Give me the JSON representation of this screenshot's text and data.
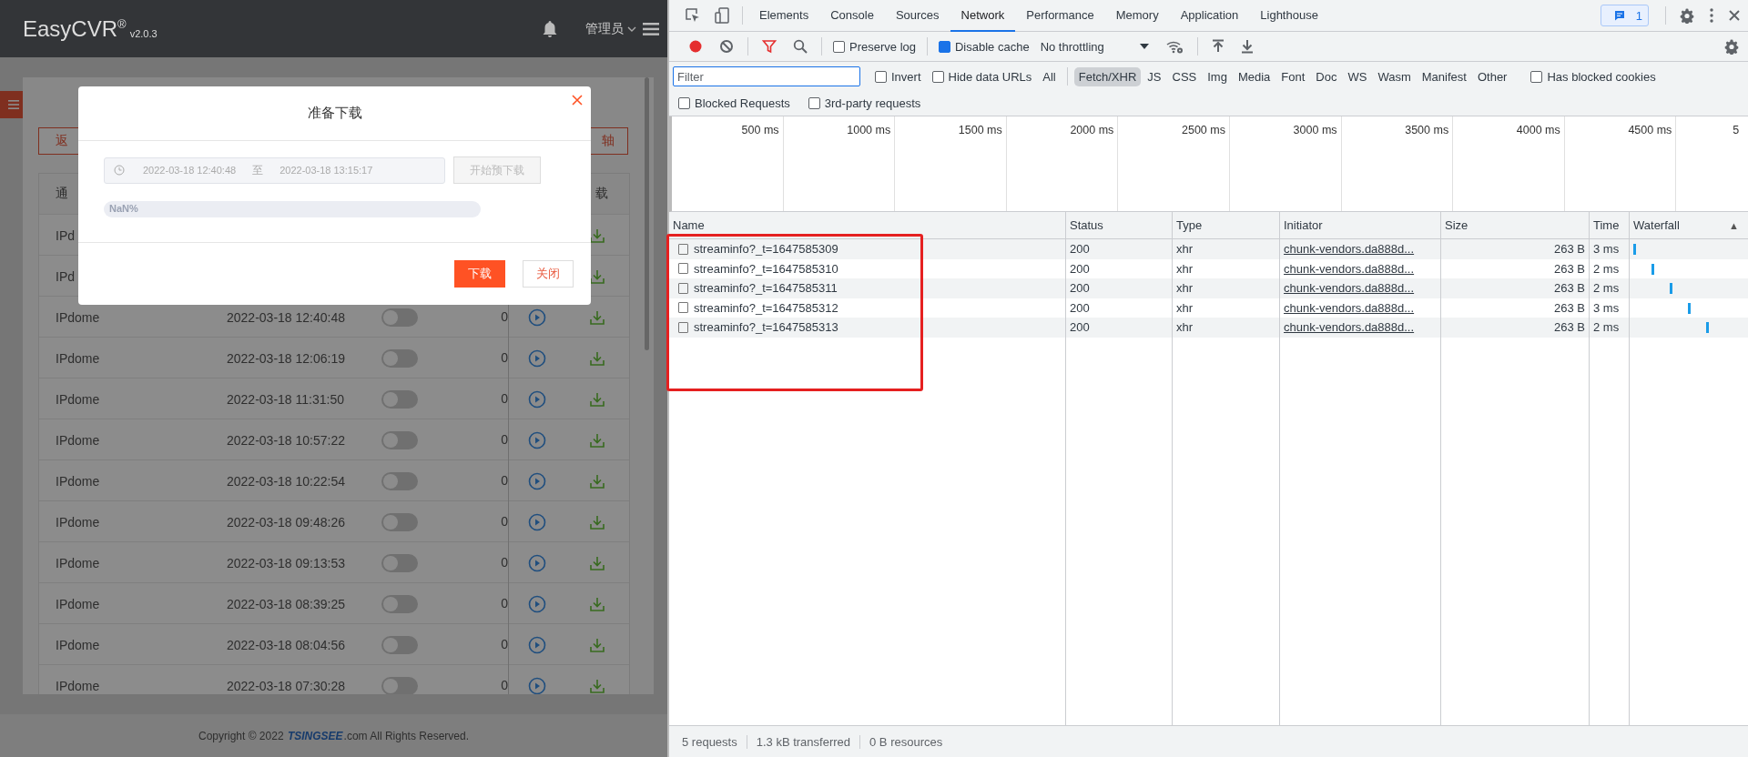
{
  "app": {
    "header": {
      "logo": "EasyCVR$^{®}$",
      "version": "v2.0.3",
      "user": "管理员"
    },
    "toolbar": {
      "back_button": "返",
      "timeline_button": "轴"
    },
    "table": {
      "columns": [
        "通",
        "载"
      ],
      "rows": [
        {
          "channel": "IPd"
        },
        {
          "channel": "IPd"
        },
        {
          "channel": "IPdome",
          "time": "2022-03-18 12:40:48",
          "on": false,
          "duration": "0"
        },
        {
          "channel": "IPdome",
          "time": "2022-03-18 12:06:19",
          "on": false,
          "duration": "0"
        },
        {
          "channel": "IPdome",
          "time": "2022-03-18 11:31:50",
          "on": false,
          "duration": "0"
        },
        {
          "channel": "IPdome",
          "time": "2022-03-18 10:57:22",
          "on": false,
          "duration": "0"
        },
        {
          "channel": "IPdome",
          "time": "2022-03-18 10:22:54",
          "on": false,
          "duration": "0"
        },
        {
          "channel": "IPdome",
          "time": "2022-03-18 09:48:26",
          "on": false,
          "duration": "0"
        },
        {
          "channel": "IPdome",
          "time": "2022-03-18 09:13:53",
          "on": false,
          "duration": "0"
        },
        {
          "channel": "IPdome",
          "time": "2022-03-18 08:39:25",
          "on": false,
          "duration": "0"
        },
        {
          "channel": "IPdome",
          "time": "2022-03-18 08:04:56",
          "on": false,
          "duration": "0"
        },
        {
          "channel": "IPdome",
          "time": "2022-03-18 07:30:28",
          "on": false,
          "duration": "0"
        }
      ]
    },
    "footer": {
      "before": "Copyright © 2022",
      "brand": "TSINGSEE",
      "after": ".com All Rights Reserved."
    }
  },
  "dialog": {
    "title": "准备下载",
    "start": "2022-03-18 12:40:48",
    "separator": "至",
    "end": "2022-03-18 13:15:17",
    "prepare_button": {
      "label": "开始预下载",
      "disabled": true
    },
    "progress": {
      "label": "NaN%",
      "level": 0
    },
    "buttons": [
      {
        "label": "下载",
        "kind": "primary"
      },
      {
        "label": "关闭",
        "kind": "secondary"
      }
    ]
  },
  "devtools": {
    "tabs": [
      {
        "label": "Elements",
        "selected": false
      },
      {
        "label": "Console",
        "selected": false
      },
      {
        "label": "Sources",
        "selected": false
      },
      {
        "label": "Network",
        "selected": true
      },
      {
        "label": "Performance",
        "selected": false
      },
      {
        "label": "Memory",
        "selected": false
      },
      {
        "label": "Application",
        "selected": false
      },
      {
        "label": "Lighthouse",
        "selected": false
      }
    ],
    "issues_count": "1",
    "toolbar": {
      "recording": true,
      "preserve_log": {
        "label": "Preserve log",
        "checked": false
      },
      "disable_cache": {
        "label": "Disable cache",
        "checked": true
      },
      "throttling": "No throttling"
    },
    "filter": {
      "placeholder": "Filter",
      "invert": {
        "label": "Invert",
        "checked": false
      },
      "hide_data_urls": {
        "label": "Hide data URLs",
        "checked": false
      },
      "types": [
        {
          "label": "All",
          "selected": false
        },
        {
          "label": "Fetch/XHR",
          "selected": true
        },
        {
          "label": "JS",
          "selected": false
        },
        {
          "label": "CSS",
          "selected": false
        },
        {
          "label": "Img",
          "selected": false
        },
        {
          "label": "Media",
          "selected": false
        },
        {
          "label": "Font",
          "selected": false
        },
        {
          "label": "Doc",
          "selected": false
        },
        {
          "label": "WS",
          "selected": false
        },
        {
          "label": "Wasm",
          "selected": false
        },
        {
          "label": "Manifest",
          "selected": false
        },
        {
          "label": "Other",
          "selected": false
        }
      ],
      "has_blocked_cookies": {
        "label": "Has blocked cookies",
        "checked": false
      },
      "blocked_requests": {
        "label": "Blocked Requests",
        "checked": false
      },
      "third_party": {
        "label": "3rd-party requests",
        "checked": false
      }
    },
    "overview_ticks": [
      "500 ms",
      "1000 ms",
      "1500 ms",
      "2000 ms",
      "2500 ms",
      "3000 ms",
      "3500 ms",
      "4000 ms",
      "4500 ms",
      "5"
    ],
    "columns": [
      "Name",
      "Status",
      "Type",
      "Initiator",
      "Size",
      "Time",
      "Waterfall"
    ],
    "sort_indicator": "▲",
    "rows": [
      {
        "name": "streaminfo?_t=1647585309",
        "status": "200",
        "type": "xhr",
        "initiator": "chunk-vendors.da888d...",
        "size": "263 B",
        "time": "3 ms"
      },
      {
        "name": "streaminfo?_t=1647585310",
        "status": "200",
        "type": "xhr",
        "initiator": "chunk-vendors.da888d...",
        "size": "263 B",
        "time": "2 ms"
      },
      {
        "name": "streaminfo?_t=1647585311",
        "status": "200",
        "type": "xhr",
        "initiator": "chunk-vendors.da888d...",
        "size": "263 B",
        "time": "2 ms"
      },
      {
        "name": "streaminfo?_t=1647585312",
        "status": "200",
        "type": "xhr",
        "initiator": "chunk-vendors.da888d...",
        "size": "263 B",
        "time": "3 ms"
      },
      {
        "name": "streaminfo?_t=1647585313",
        "status": "200",
        "type": "xhr",
        "initiator": "chunk-vendors.da888d...",
        "size": "263 B",
        "time": "2 ms"
      }
    ],
    "status_bar": [
      "5 requests",
      "1.3 kB transferred",
      "0 B resources"
    ]
  }
}
